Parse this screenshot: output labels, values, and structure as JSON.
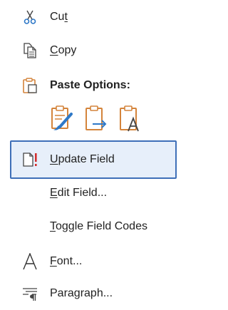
{
  "menu": {
    "cut": {
      "label_underline": "t",
      "label_prefix": "Cu",
      "label_suffix": "",
      "icon": "scissors-icon"
    },
    "copy": {
      "label_underline": "C",
      "label_prefix": "",
      "label_suffix": "opy",
      "icon": "copy-icon"
    },
    "paste_options": {
      "label": "Paste Options:",
      "icon": "clipboard-icon",
      "options": [
        "keep-source-formatting-icon",
        "merge-formatting-icon",
        "keep-text-only-icon"
      ]
    },
    "update_field": {
      "label_underline": "U",
      "label_prefix": "",
      "label_suffix": "pdate Field",
      "icon": "update-field-icon"
    },
    "edit_field": {
      "label_underline": "E",
      "label_prefix": "",
      "label_suffix": "dit Field..."
    },
    "toggle_field_codes": {
      "label_underline": "T",
      "label_prefix": "",
      "label_suffix": "oggle Field Codes"
    },
    "font": {
      "label_underline": "F",
      "label_prefix": "",
      "label_suffix": "ont...",
      "icon": "font-icon"
    },
    "paragraph": {
      "label_underline": "",
      "label_prefix": "Paragraph...",
      "label_suffix": "",
      "icon": "paragraph-icon"
    }
  },
  "colors": {
    "highlight_bg": "#e7effa",
    "highlight_border": "#3f6fb8",
    "icon_orange": "#d4843b",
    "icon_blue": "#2e78c7",
    "icon_red": "#d32f2f",
    "icon_gray": "#444444"
  }
}
